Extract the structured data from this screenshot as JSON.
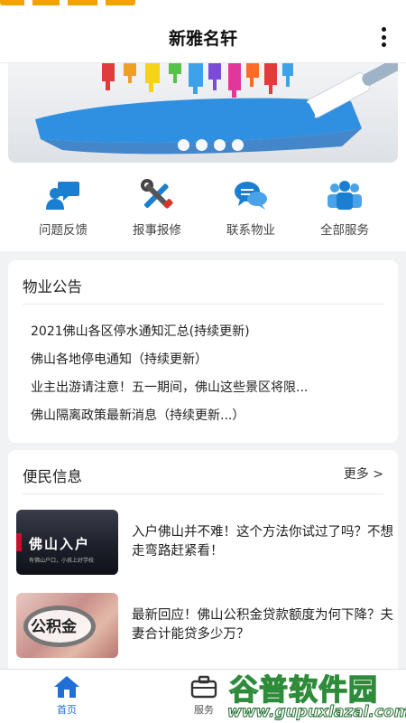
{
  "header": {
    "title": "新雅名轩"
  },
  "icons": {
    "more": "more-vertical-icon"
  },
  "banner": {
    "slide_count": 4,
    "active_slide": 1
  },
  "quick_actions": [
    {
      "label": "问题反馈",
      "icon": "feedback-icon"
    },
    {
      "label": "报事报修",
      "icon": "repair-tools-icon"
    },
    {
      "label": "联系物业",
      "icon": "chat-bubbles-icon"
    },
    {
      "label": "全部服务",
      "icon": "group-icon"
    }
  ],
  "notice": {
    "title": "物业公告",
    "items": [
      "2021佛山各区停水通知汇总(持续更新)",
      "佛山各地停电通知（持续更新）",
      "业主出游请注意！五一期间，佛山这些景区将限...",
      "佛山隔离政策最新消息（持续更新...）"
    ]
  },
  "info": {
    "title": "便民信息",
    "more_label": "更多 >",
    "articles": [
      {
        "title": "入户佛山并不难！这个方法你试过了吗？不想走弯路赶紧看！",
        "thumb_text": "佛山入户",
        "thumb_subtext": "有佛山户口，小孩上好学校"
      },
      {
        "title": "最新回应！佛山公积金贷款额度为何下降？夫妻合计能贷多少万？",
        "thumb_text": "公积金"
      }
    ]
  },
  "tabbar": {
    "tabs": [
      {
        "label": "首页",
        "active": true
      },
      {
        "label": "服务",
        "active": false
      }
    ]
  },
  "watermark": {
    "text": "谷普软件园",
    "url": "www.gupuxlazal.com"
  },
  "colors": {
    "accent": "#1f6fd6",
    "icon_blue": "#1b7fd1",
    "background": "#f1f2f4"
  }
}
